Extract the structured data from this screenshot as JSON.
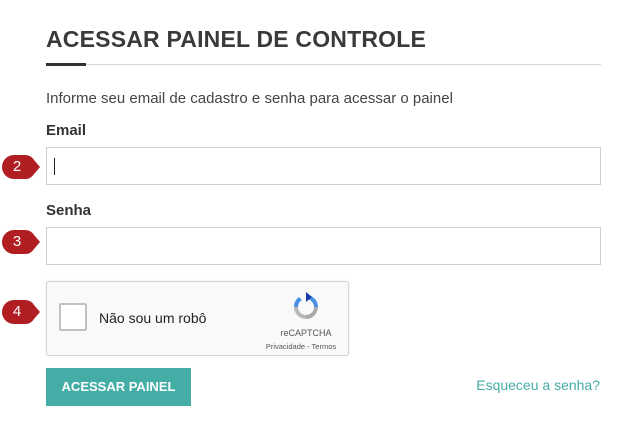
{
  "title": "ACESSAR PAINEL DE CONTROLE",
  "subtitle": "Informe seu email de cadastro e senha para acessar o painel",
  "form": {
    "email_label": "Email",
    "email_value": "",
    "senha_label": "Senha",
    "senha_value": ""
  },
  "markers": [
    "2",
    "3",
    "4"
  ],
  "recaptcha": {
    "label": "Não sou um robô",
    "brand": "reCAPTCHA",
    "links": "Privacidade - Termos",
    "icon": "recaptcha-logo-icon"
  },
  "submit_label": "ACESSAR PAINEL",
  "forgot_label": "Esqueceu a senha?",
  "colors": {
    "accent": "#44ada6",
    "marker": "#b01e22",
    "title": "#3a3a3a"
  }
}
